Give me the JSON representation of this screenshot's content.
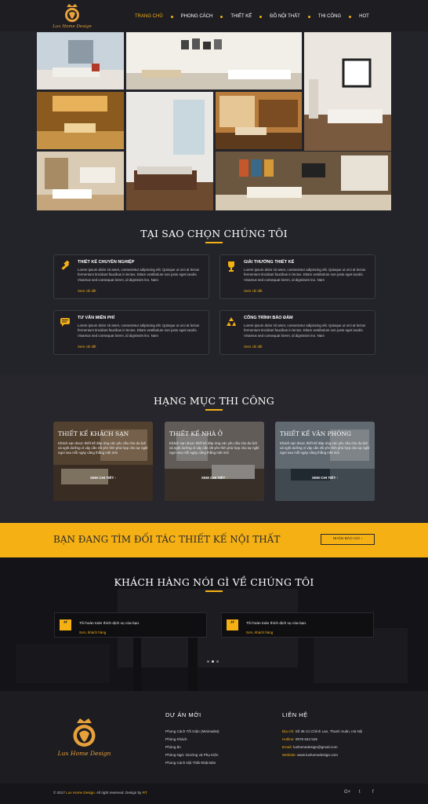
{
  "header": {
    "logo_text": "Lux Home Design",
    "nav": [
      "TRANG CHỦ",
      "PHONG CÁCH",
      "THIẾT KẾ",
      "ĐỒ NỘI THẤT",
      "THI CÔNG",
      "HOT"
    ]
  },
  "why": {
    "title": "TẠI SAO CHỌN CHÚNG TÔI",
    "items": [
      {
        "title": "THIẾT KẾ CHUYÊN NGHIỆP",
        "desc": "Lorem ipsum dolor sit amet, consectetur adipiscing elit. Quisque ut orci at lectus fermentum tincidunt faucibus in lectus. Etiam vestibulum non justo eget iaculis. Vivamus sed consequat lorem, id dignissim leo. Nam",
        "more": "Xem chi tiết",
        "icon": "hammer-icon"
      },
      {
        "title": "GIẢI THƯỞNG THIẾT KẾ",
        "desc": "Lorem ipsum dolor sit amet, consectetur adipiscing elit. Quisque ut orci at lectus fermentum tincidunt faucibus in lectus. Etiam vestibulum non justo eget iaculis. Vivamus sed consequat lorem, id dignissim leo. Nam",
        "more": "Xem chi tiết",
        "icon": "trophy-icon"
      },
      {
        "title": "TƯ VẤN MIỄN PHÍ",
        "desc": "Lorem ipsum dolor sit amet, consectetur adipiscing elit. Quisque ut orci at lectus fermentum tincidunt faucibus in lectus. Etiam vestibulum non justo eget iaculis. Vivamus sed consequat lorem, id dignissim leo. Nam",
        "more": "Xem chi tiết",
        "icon": "chat-icon"
      },
      {
        "title": "CÔNG TRÌNH BẢO ĐẢM",
        "desc": "Lorem ipsum dolor sit amet, consectetur adipiscing elit. Quisque ut orci at lectus fermentum tincidunt faucibus in lectus. Etiam vestibulum non justo eget iaculis. Vivamus sed consequat lorem, id dignissim leo. Nam",
        "more": "Xem chi tiết",
        "icon": "recycle-icon"
      }
    ]
  },
  "services": {
    "title": "HẠNG MỤC THI CÔNG",
    "items": [
      {
        "title": "THIẾT KẾ KHÁCH SẠN",
        "desc": "Khách sạn được thiết kế đáp ứng các yêu cầu cho du lịch và nghỉ dưỡng vì vậy cần rất yên tĩnh phù hợp cho sự nghỉ ngơi sau mỗi ngày căng thẳng mệt mỏi",
        "button": "XEM CHI TIẾT"
      },
      {
        "title": "THIẾT KẾ NHÀ Ở",
        "desc": "Khách sạn được thiết kế đáp ứng các yêu cầu cho du lịch và nghỉ dưỡng vì vậy cần rất yên tĩnh phù hợp cho sự nghỉ ngơi sau mỗi ngày căng thẳng mệt mỏi",
        "button": "XEM CHI TIẾT"
      },
      {
        "title": "THIẾT KẾ VĂN PHÒNG",
        "desc": "Khách sạn được thiết kế đáp ứng các yêu cầu cho du lịch và nghỉ dưỡng vì vậy cần rất yên tĩnh phù hợp cho sự nghỉ ngơi sau mỗi ngày căng thẳng mệt mỏi",
        "button": "XEM CHI TIẾT"
      }
    ]
  },
  "cta": {
    "title": "BẠN ĐANG TÌM ĐỐI TÁC THIẾT KẾ NỘI THẤT",
    "button": "NHẬN BÁO GIÁ"
  },
  "testimonials": {
    "title": "KHÁCH HÀNG NÓI GÌ VỀ CHÚNG TÔI",
    "items": [
      {
        "quote": "Tôi hoàn toàn thích dịch vụ của bạn.",
        "author": "Sơn, khách hàng"
      },
      {
        "quote": "Tôi hoàn toàn thích dịch vụ của bạn.",
        "author": "Sơn, khách hàng"
      }
    ],
    "pages": 3,
    "active_page": 2
  },
  "footer": {
    "logo_text": "Lux Home Design",
    "projects_title": "DỰ ÁN MỚI",
    "projects": [
      "Phong Cách Tối Giản (Minimalist)",
      "Phòng Khách",
      "Phòng ăn",
      "Phòng Ngủ: Giường và Phụ Kiện",
      "Phong Cách Nội Thất Nhật Bản"
    ],
    "contact_title": "LIÊN HỆ",
    "contact": [
      {
        "label": "Địa chỉ:",
        "value": "Số 36 Cù Chính Lan, Thanh Xuân, Hà Nội"
      },
      {
        "label": "Hotline:",
        "value": "0979 842 525"
      },
      {
        "label": "Email:",
        "value": "luxhomedesign@gmail.com"
      },
      {
        "label": "Website:",
        "value": "www.luxhomedesign.com"
      }
    ],
    "copyright_pre": "© 2017",
    "copyright_brand": "Lux Home Design.",
    "copyright_post": "All right reserved. Design by",
    "copyright_designer": "RT",
    "social": [
      "G+",
      "t",
      "f"
    ]
  },
  "colors": {
    "accent": "#f5b014",
    "dark": "#23232a"
  }
}
